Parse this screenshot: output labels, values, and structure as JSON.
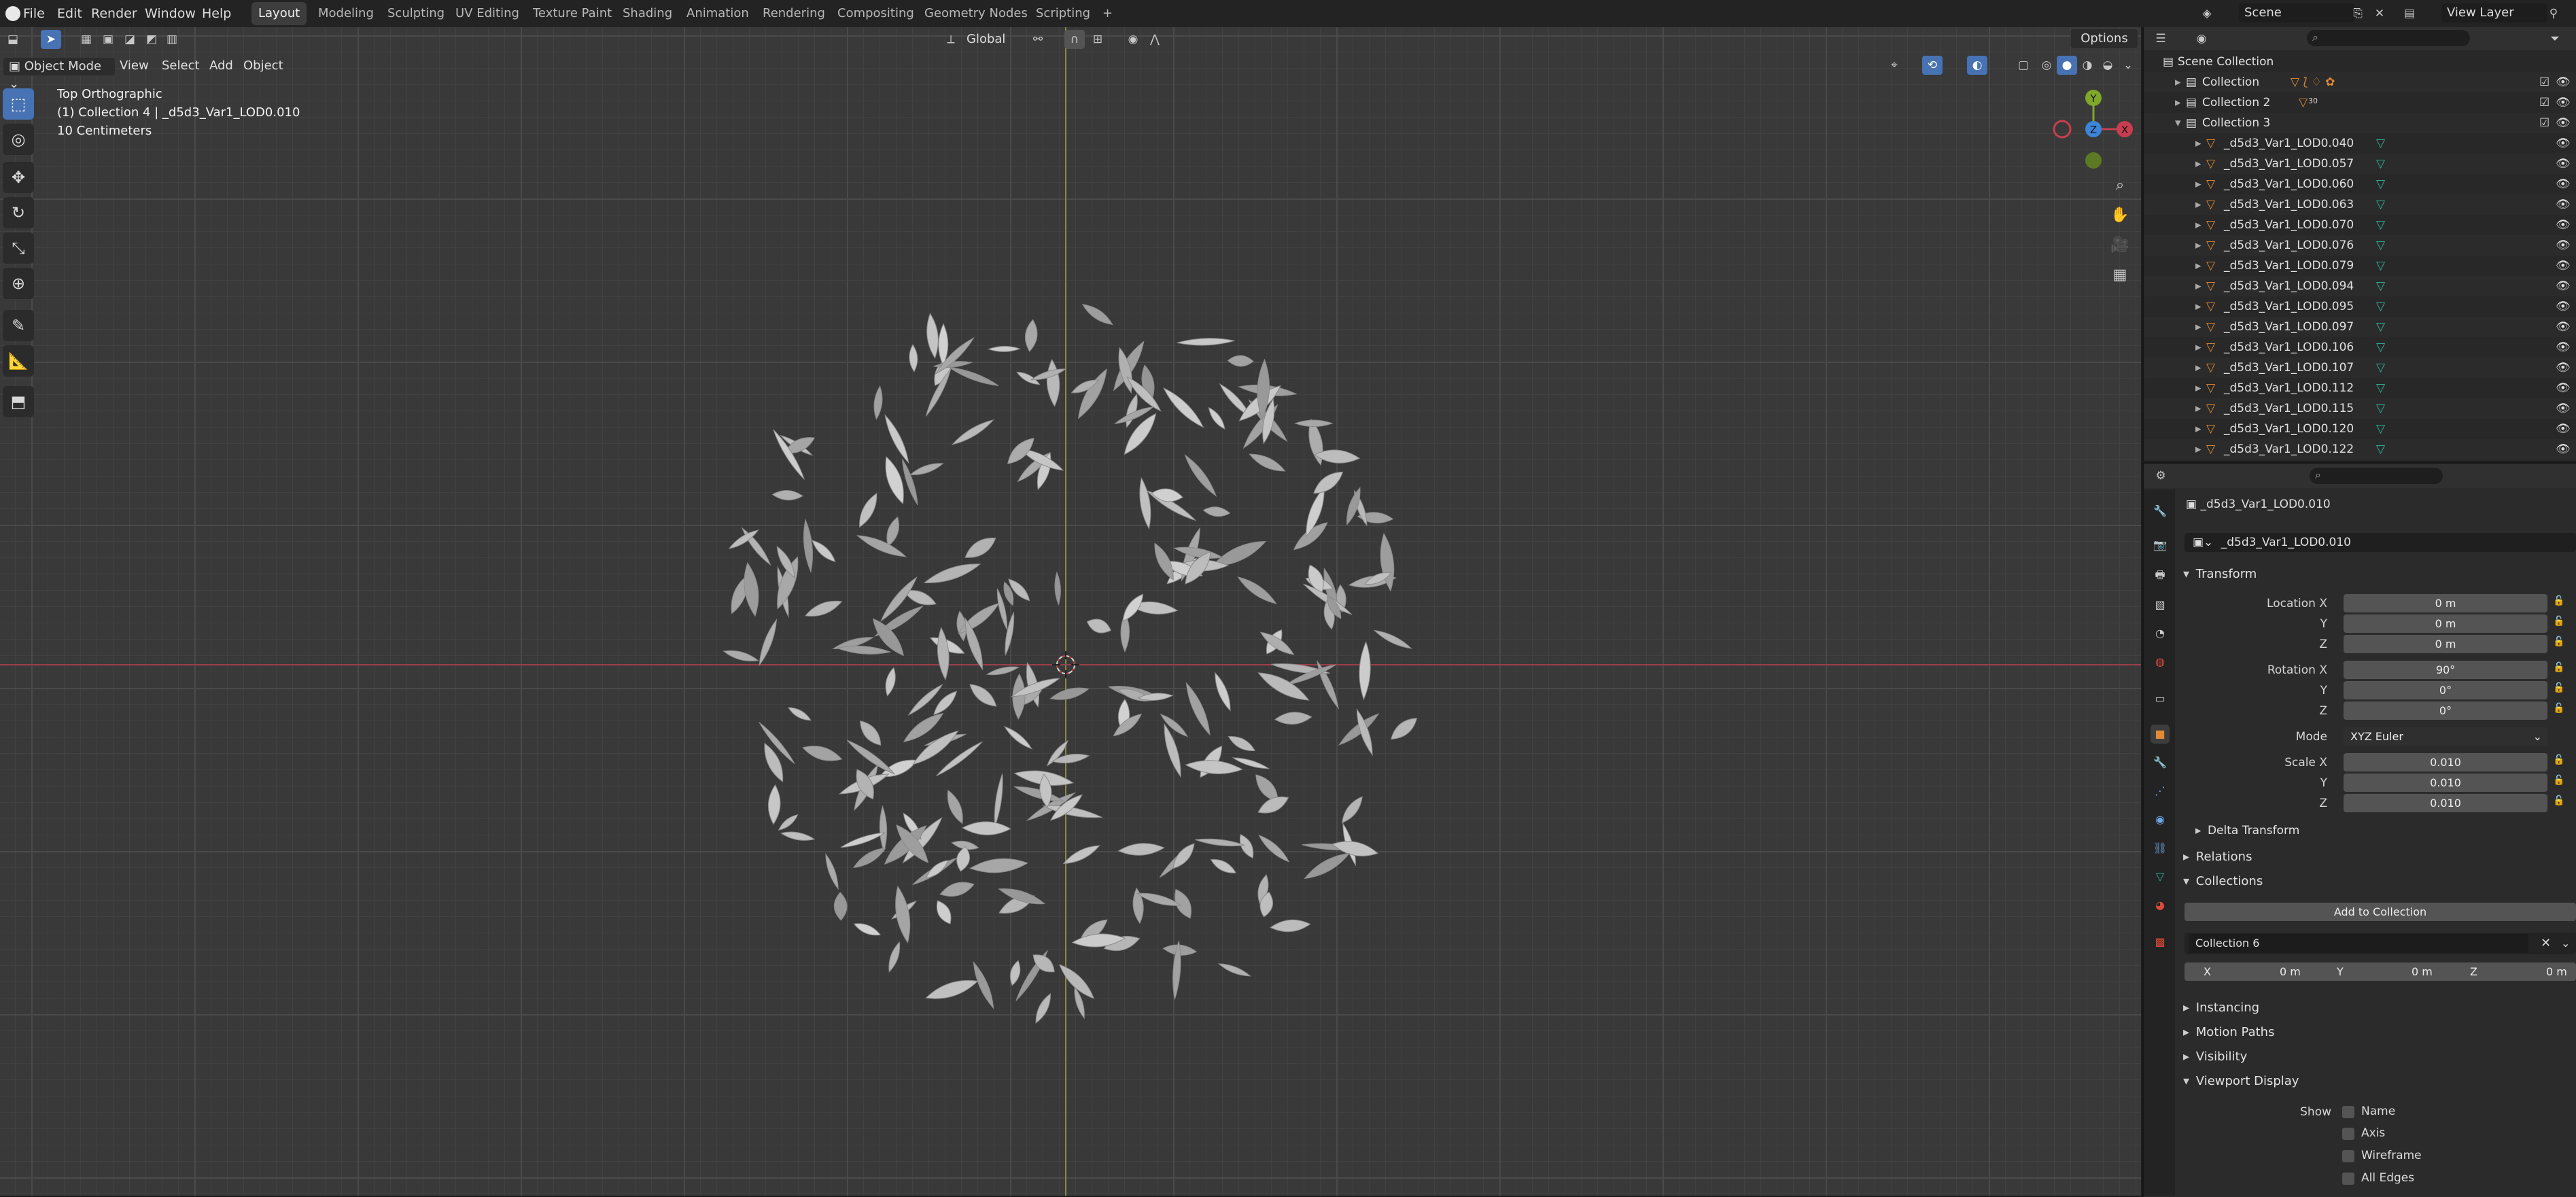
{
  "menus": [
    "File",
    "Edit",
    "Render",
    "Window",
    "Help"
  ],
  "workspaces": [
    {
      "label": "Layout",
      "active": true
    },
    {
      "label": "Modeling"
    },
    {
      "label": "Sculpting"
    },
    {
      "label": "UV Editing"
    },
    {
      "label": "Texture Paint"
    },
    {
      "label": "Shading"
    },
    {
      "label": "Animation"
    },
    {
      "label": "Rendering"
    },
    {
      "label": "Compositing"
    },
    {
      "label": "Geometry Nodes"
    },
    {
      "label": "Scripting"
    }
  ],
  "add_workspace": "+",
  "scene": "Scene",
  "view_layer": "View Layer",
  "tool_header": {
    "orientation": "Global",
    "options": "Options"
  },
  "viewport": {
    "mode": "Object Mode",
    "menus": [
      "View",
      "Select",
      "Add",
      "Object"
    ],
    "info_view": "Top Orthographic",
    "info_object": "(1) Collection 4 | _d5d3_Var1_LOD0.010",
    "info_scale": "10 Centimeters",
    "gizmo": {
      "x": "X",
      "y": "Y",
      "z": "Z"
    }
  },
  "outliner": {
    "root": "Scene Collection",
    "collections": [
      "Collection",
      "Collection 2",
      "Collection 3"
    ],
    "objects": [
      "_d5d3_Var1_LOD0.040",
      "_d5d3_Var1_LOD0.057",
      "_d5d3_Var1_LOD0.060",
      "_d5d3_Var1_LOD0.063",
      "_d5d3_Var1_LOD0.070",
      "_d5d3_Var1_LOD0.076",
      "_d5d3_Var1_LOD0.079",
      "_d5d3_Var1_LOD0.094",
      "_d5d3_Var1_LOD0.095",
      "_d5d3_Var1_LOD0.097",
      "_d5d3_Var1_LOD0.106",
      "_d5d3_Var1_LOD0.107",
      "_d5d3_Var1_LOD0.112",
      "_d5d3_Var1_LOD0.115",
      "_d5d3_Var1_LOD0.120",
      "_d5d3_Var1_LOD0.122"
    ],
    "collection2_badge": "30"
  },
  "properties": {
    "object_name": "_d5d3_Var1_LOD0.010",
    "datablock_name": "_d5d3_Var1_LOD0.010",
    "transform": {
      "header": "Transform",
      "location_label": "Location X",
      "location": [
        "0 m",
        "0 m",
        "0 m"
      ],
      "rotation_label": "Rotation X",
      "rotation": [
        "90°",
        "0°",
        "0°"
      ],
      "mode_label": "Mode",
      "mode": "XYZ Euler",
      "scale_label": "Scale X",
      "scale": [
        "0.010",
        "0.010",
        "0.010"
      ],
      "y_label": "Y",
      "z_label": "Z"
    },
    "delta_transform": "Delta Transform",
    "relations": "Relations",
    "collections": {
      "header": "Collections",
      "add_button": "Add to Collection",
      "collection_name": "Collection 6",
      "offset_labels": [
        "X",
        "Y",
        "Z"
      ],
      "offset_values": [
        "0 m",
        "0 m",
        "0 m"
      ]
    },
    "instancing": "Instancing",
    "motion_paths": "Motion Paths",
    "visibility": "Visibility",
    "viewport_display": {
      "header": "Viewport Display",
      "show_label": "Show",
      "options": [
        "Name",
        "Axis",
        "Wireframe",
        "All Edges"
      ]
    }
  },
  "colors": {
    "accent": "#4772b3",
    "object_orange": "#e08a36",
    "mesh_green": "#2fb89b",
    "axis_x": "#c73e4f",
    "axis_y": "#7fa72a",
    "axis_z": "#3b86d8",
    "leaf": "#a7a7a7"
  }
}
